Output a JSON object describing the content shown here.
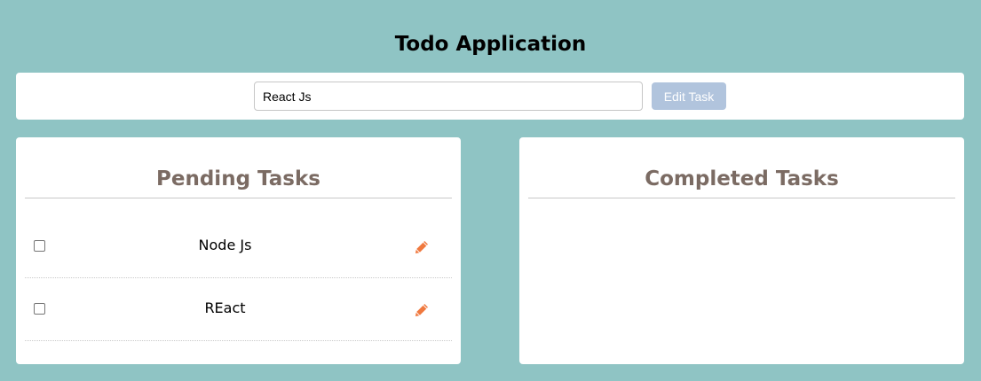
{
  "app": {
    "title": "Todo Application"
  },
  "input_bar": {
    "input_value": "React Js",
    "edit_button_label": "Edit Task"
  },
  "pending": {
    "heading": "Pending Tasks",
    "tasks": [
      {
        "label": "Node Js",
        "checked": false,
        "action_icon": "pencil-icon"
      },
      {
        "label": "REact",
        "checked": false,
        "action_icon": "pencil-icon"
      }
    ]
  },
  "completed": {
    "heading": "Completed Tasks",
    "tasks": []
  },
  "colors": {
    "background": "#8fc4c4",
    "heading_text": "#7b6b63",
    "edit_button": "#b1c4dd",
    "pencil_icon": "#f0793f"
  }
}
